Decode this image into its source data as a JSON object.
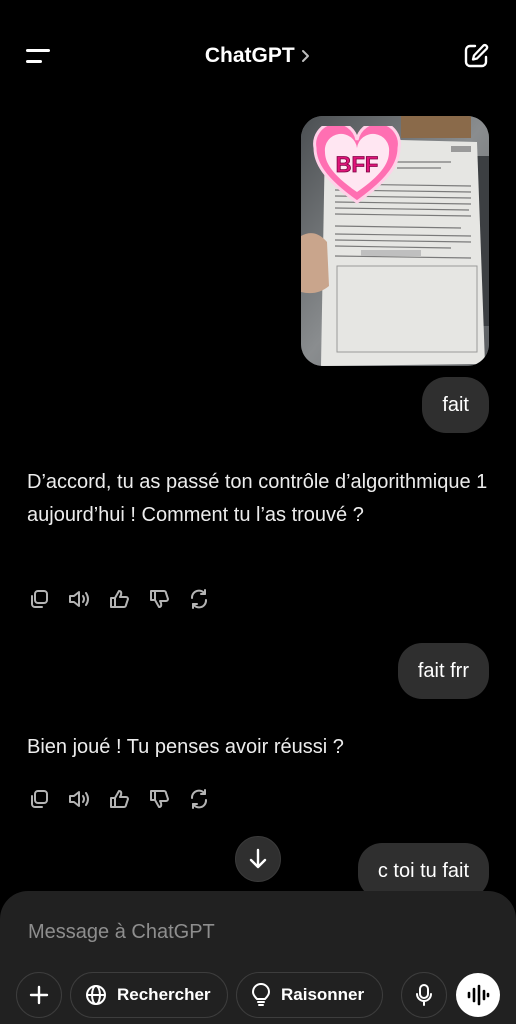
{
  "header": {
    "title": "ChatGPT"
  },
  "photo": {
    "sticker_text": "BFF"
  },
  "messages": [
    {
      "role": "user",
      "text": "fait"
    },
    {
      "role": "assistant",
      "text": "D’accord, tu as passé ton contrôle d’algorithmique 1 aujourd’hui ! Comment tu l’as trouvé ?"
    },
    {
      "role": "user",
      "text": "fait frr"
    },
    {
      "role": "assistant",
      "text": "Bien joué ! Tu penses avoir réussi ?"
    },
    {
      "role": "user",
      "text": "c toi tu fait"
    }
  ],
  "composer": {
    "placeholder": "Message à ChatGPT",
    "search_label": "Rechercher",
    "reason_label": "Raisonner"
  },
  "icons": {
    "menu": "hamburger-menu-icon",
    "new_chat": "new-chat-icon",
    "copy": "copy-icon",
    "read_aloud": "speaker-icon",
    "thumbs_up": "thumbs-up-icon",
    "thumbs_down": "thumbs-down-icon",
    "regenerate": "refresh-icon",
    "scroll_down": "arrow-down-icon",
    "plus": "plus-icon",
    "globe": "globe-icon",
    "bulb": "lightbulb-icon",
    "mic": "mic-icon",
    "voice": "voice-waveform-icon"
  },
  "colors": {
    "background": "#000000",
    "bubble": "#2f2f2f",
    "composer": "#212121",
    "sticker_pink": "#ff6fb2"
  }
}
